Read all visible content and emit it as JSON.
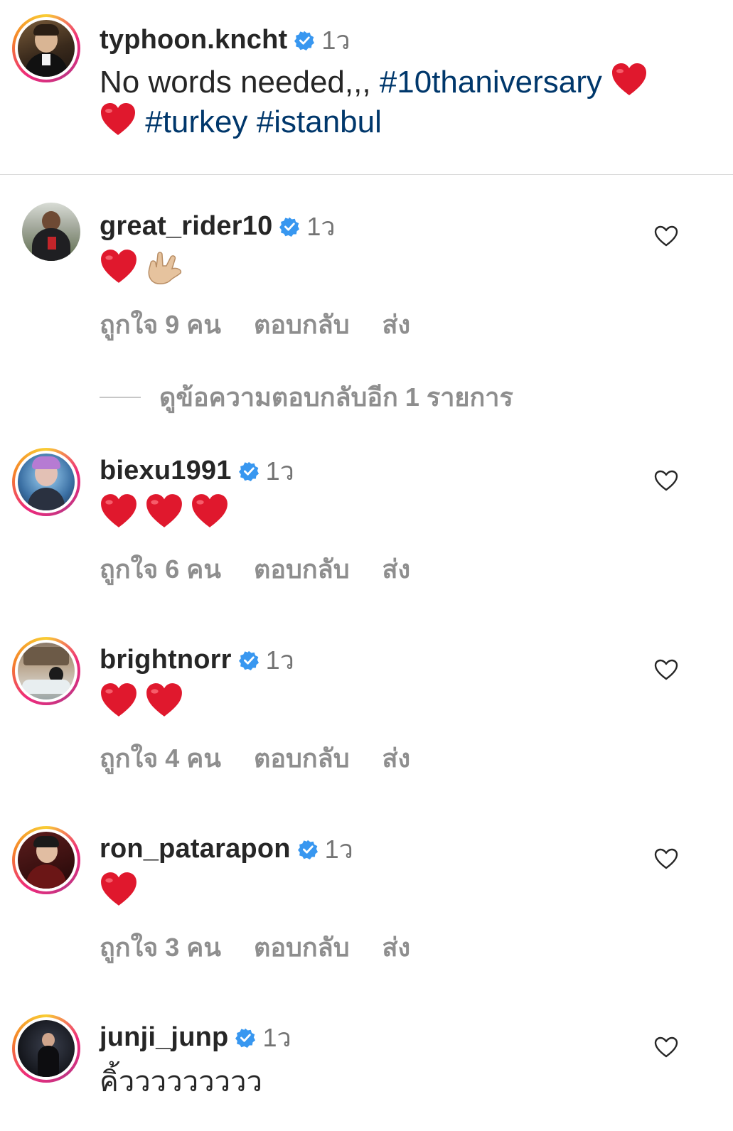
{
  "post": {
    "username": "typhoon.kncht",
    "time": "1ว",
    "caption_text": "No words needed,,, ",
    "tags": [
      "#10thaniversary",
      "#turkey",
      "#istanbul"
    ],
    "verified": true
  },
  "comments": [
    {
      "username": "great_rider10",
      "time": "1ว",
      "verified": true,
      "text": "❤️🤟🏼",
      "likes_label": "ถูกใจ 9 คน",
      "reply_label": "ตอบกลับ",
      "send_label": "ส่ง",
      "view_replies": "ดูข้อความตอบกลับอีก 1 รายการ"
    },
    {
      "username": "biexu1991",
      "time": "1ว",
      "verified": true,
      "text": "❤️❤️❤️",
      "likes_label": "ถูกใจ 6 คน",
      "reply_label": "ตอบกลับ",
      "send_label": "ส่ง"
    },
    {
      "username": "brightnorr",
      "time": "1ว",
      "verified": true,
      "text": "❤️❤️",
      "likes_label": "ถูกใจ 4 คน",
      "reply_label": "ตอบกลับ",
      "send_label": "ส่ง"
    },
    {
      "username": "ron_patarapon",
      "time": "1ว",
      "verified": true,
      "text": "❤️",
      "likes_label": "ถูกใจ 3 คน",
      "reply_label": "ตอบกลับ",
      "send_label": "ส่ง"
    },
    {
      "username": "junji_junp",
      "time": "1ว",
      "verified": true,
      "text": "คิ้ววววววววว"
    }
  ],
  "colors": {
    "hashtag": "#00376b",
    "verified": "#3897f0",
    "heart_emoji": "#e0182d",
    "muted": "#8e8e8e"
  }
}
